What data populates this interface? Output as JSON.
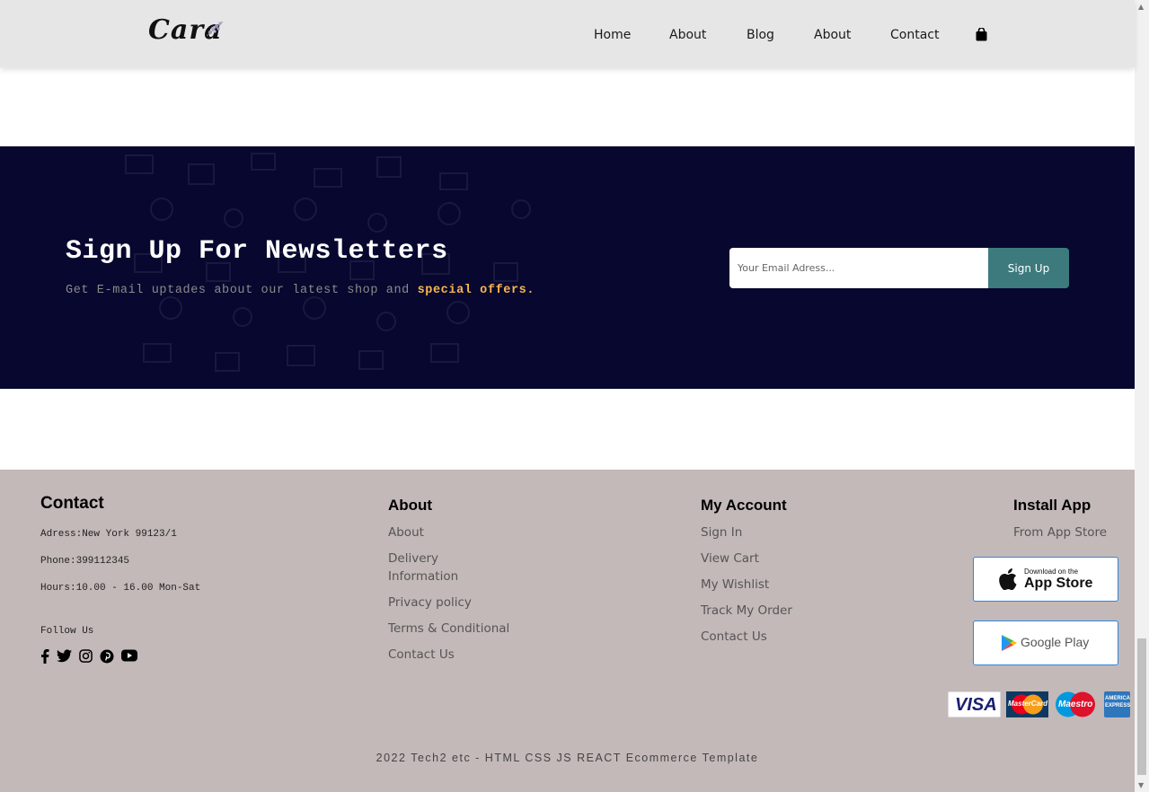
{
  "header": {
    "logo_text": "Cara",
    "nav": [
      "Home",
      "About",
      "Blog",
      "About",
      "Contact"
    ],
    "cart_icon": "shopping-bag-icon"
  },
  "newsletter": {
    "title": "Sign Up For Newsletters",
    "subtitle_prefix": "Get E-mail uptades about our latest shop and ",
    "subtitle_highlight": "special offers.",
    "email_placeholder": "Your Email Adress...",
    "button_label": "Sign Up",
    "colors": {
      "background": "#07072f",
      "button": "#3c7a7e",
      "highlight": "#f8b64c"
    }
  },
  "footer": {
    "contact": {
      "title": "Contact",
      "address": "Adress:New York 99123/1",
      "phone": "Phone:399112345",
      "hours": "Hours:10.00 - 16.00 Mon-Sat",
      "follow": "Follow Us",
      "social_icons": [
        "facebook-icon",
        "twitter-icon",
        "instagram-icon",
        "pinterest-icon",
        "youtube-icon"
      ]
    },
    "about": {
      "title": "About",
      "links": [
        "About",
        "Delivery",
        "Information",
        "Privacy policy",
        "Terms & Conditional",
        "Contact Us"
      ]
    },
    "account": {
      "title": "My Account",
      "links": [
        "Sign In",
        "View Cart",
        "My Wishlist",
        "Track My Order",
        "Contact Us"
      ]
    },
    "install": {
      "title": "Install App",
      "subtitle": "From App Store",
      "appstore_small": "Download on the",
      "appstore_big": "App Store",
      "googleplay": "Google Play"
    },
    "payments": [
      "VISA",
      "MasterCard",
      "Maestro",
      "AMERICAN EXPRESS"
    ],
    "copyright": "2022 Tech2 etc - HTML CSS JS REACT Ecommerce Template",
    "colors": {
      "background": "#c3b9b8"
    }
  }
}
